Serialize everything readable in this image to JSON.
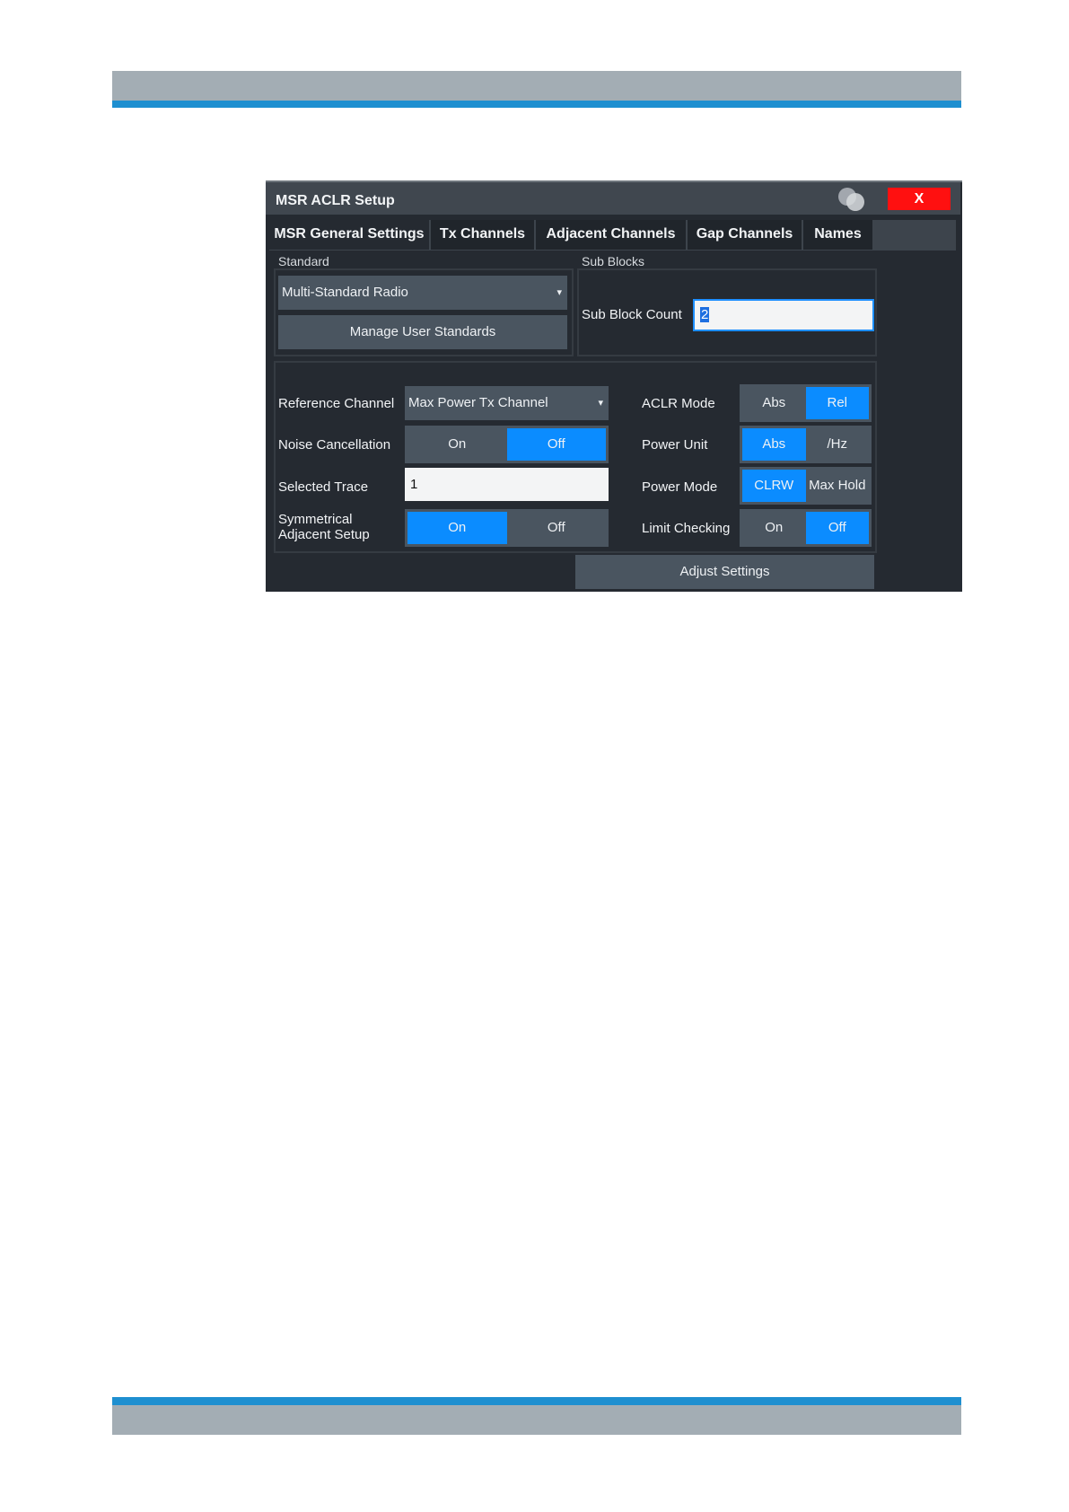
{
  "dialog": {
    "title": "MSR ACLR Setup",
    "close_label": "X"
  },
  "tabs": [
    {
      "label": "MSR General Settings",
      "active": true
    },
    {
      "label": "Tx Channels",
      "active": false
    },
    {
      "label": "Adjacent Channels",
      "active": false
    },
    {
      "label": "Gap Channels",
      "active": false
    },
    {
      "label": "Names",
      "active": false
    }
  ],
  "standard": {
    "group_label": "Standard",
    "value": "Multi-Standard Radio",
    "manage_button": "Manage User Standards"
  },
  "sub_blocks": {
    "group_label": "Sub Blocks",
    "count_label": "Sub Block Count",
    "count_value": "2"
  },
  "settings": {
    "reference_channel": {
      "label": "Reference Channel",
      "value": "Max Power Tx Channel"
    },
    "noise_cancellation": {
      "label": "Noise Cancellation",
      "options": [
        "On",
        "Off"
      ],
      "selected": "Off"
    },
    "selected_trace": {
      "label": "Selected Trace",
      "value": "1"
    },
    "symmetrical_adjacent": {
      "label_line1": "Symmetrical",
      "label_line2": "Adjacent Setup",
      "options": [
        "On",
        "Off"
      ],
      "selected": "On"
    },
    "aclr_mode": {
      "label": "ACLR Mode",
      "options": [
        "Abs",
        "Rel"
      ],
      "selected": "Rel"
    },
    "power_unit": {
      "label": "Power Unit",
      "options": [
        "Abs",
        "/Hz"
      ],
      "selected": "Abs"
    },
    "power_mode": {
      "label": "Power Mode",
      "options": [
        "CLRW",
        "Max Hold"
      ],
      "selected": "CLRW"
    },
    "limit_checking": {
      "label": "Limit Checking",
      "options": [
        "On",
        "Off"
      ],
      "selected": "Off"
    }
  },
  "adjust_button": "Adjust Settings",
  "colors": {
    "accent_blue": "#0b8cff",
    "dialog_bg": "#252a31",
    "close_red": "#ff1010",
    "page_band_gray": "#a3adb4",
    "page_band_blue": "#1e8fd0"
  }
}
